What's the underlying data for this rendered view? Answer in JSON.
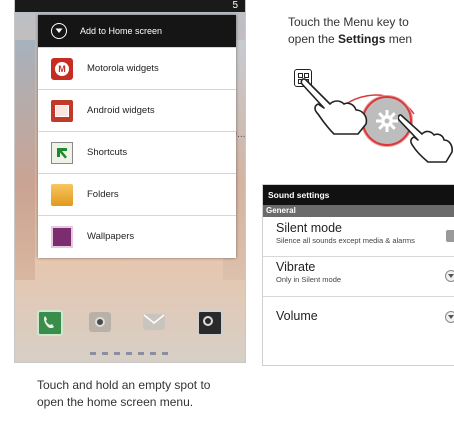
{
  "left_screenshot": {
    "status_number": "5",
    "menu": {
      "title": "Add to Home screen",
      "items": [
        {
          "label": "Motorola widgets",
          "icon": "motorola-icon"
        },
        {
          "label": "Android widgets",
          "icon": "android-widgets-icon"
        },
        {
          "label": "Shortcuts",
          "icon": "shortcuts-icon"
        },
        {
          "label": "Folders",
          "icon": "folder-icon"
        },
        {
          "label": "Wallpapers",
          "icon": "wallpaper-icon"
        }
      ]
    },
    "side_text": "he...",
    "dock_icons": [
      "phone-icon",
      "camera-icon",
      "mail-icon",
      "ring-icon"
    ]
  },
  "caption_left": "Touch and hold an empty spot to open the home screen menu.",
  "caption_right": {
    "line1": "Touch the Menu key to",
    "line2_prefix": "open the ",
    "line2_bold": "Settings",
    "line2_suffix": " men"
  },
  "settings_screenshot": {
    "title": "Sound settings",
    "category": "General",
    "rows": [
      {
        "label": "Silent mode",
        "summary": "Silence all sounds except media & alarms"
      },
      {
        "label": "Vibrate",
        "summary": "Only in Silent mode"
      },
      {
        "label": "Volume",
        "summary": ""
      }
    ]
  }
}
